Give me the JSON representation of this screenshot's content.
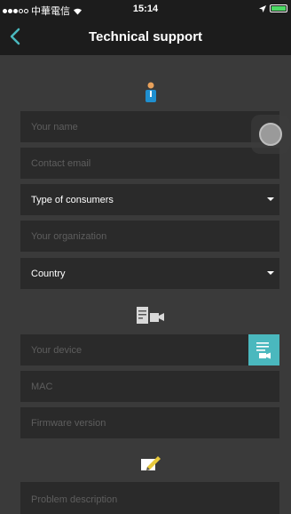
{
  "status_bar": {
    "carrier": "中華電信",
    "time": "15:14"
  },
  "nav": {
    "title": "Technical support",
    "back_icon": "chevron-left-icon"
  },
  "contact_section": {
    "icon": "person-icon",
    "name_placeholder": "Your name",
    "email_placeholder": "Contact email",
    "consumer_type_value": "Type of consumers",
    "organization_placeholder": "Your organization",
    "country_value": "Country"
  },
  "device_section": {
    "icon": "device-icon",
    "device_placeholder": "Your device",
    "mac_placeholder": "MAC",
    "firmware_placeholder": "Firmware version",
    "device_list_icon": "device-list-icon"
  },
  "problem_section": {
    "icon": "edit-icon",
    "description_placeholder": "Problem description"
  },
  "colors": {
    "accent": "#4ab8be",
    "background": "#3a3a3a",
    "field": "#2a2a2a",
    "bar": "#1c1c1c"
  }
}
